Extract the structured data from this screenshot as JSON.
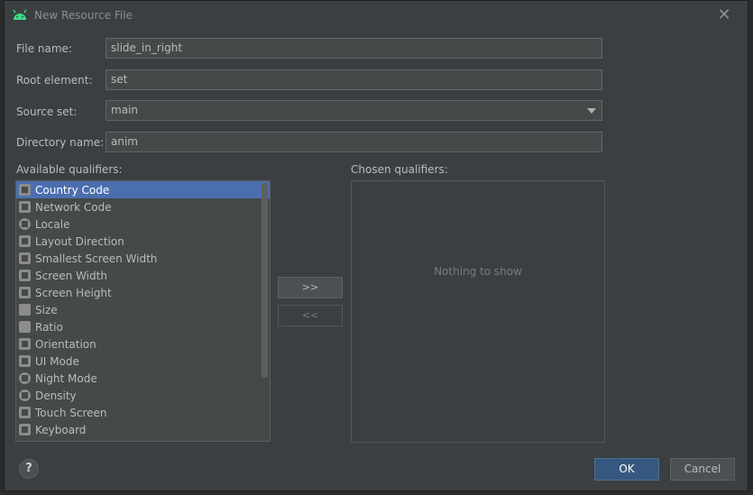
{
  "dialog": {
    "title": "New Resource File",
    "close_glyph": "✕"
  },
  "form": {
    "file_name_label": "File name:",
    "file_name_value": "slide_in_right",
    "root_element_label": "Root element:",
    "root_element_value": "set",
    "source_set_label": "Source set:",
    "source_set_value": "main",
    "directory_name_label": "Directory name:",
    "directory_name_value": "anim"
  },
  "qualifiers": {
    "available_label": "Available qualifiers:",
    "chosen_label": "Chosen qualifiers:",
    "items": [
      {
        "label": "Country Code",
        "icon": "country-code-icon"
      },
      {
        "label": "Network Code",
        "icon": "network-code-icon"
      },
      {
        "label": "Locale",
        "icon": "globe-icon"
      },
      {
        "label": "Layout Direction",
        "icon": "layout-direction-icon"
      },
      {
        "label": "Smallest Screen Width",
        "icon": "smallest-width-icon"
      },
      {
        "label": "Screen Width",
        "icon": "screen-width-icon"
      },
      {
        "label": "Screen Height",
        "icon": "screen-height-icon"
      },
      {
        "label": "Size",
        "icon": "size-icon"
      },
      {
        "label": "Ratio",
        "icon": "ratio-icon"
      },
      {
        "label": "Orientation",
        "icon": "orientation-icon"
      },
      {
        "label": "UI Mode",
        "icon": "ui-mode-icon"
      },
      {
        "label": "Night Mode",
        "icon": "night-mode-icon"
      },
      {
        "label": "Density",
        "icon": "density-icon"
      },
      {
        "label": "Touch Screen",
        "icon": "touch-screen-icon"
      },
      {
        "label": "Keyboard",
        "icon": "keyboard-icon"
      }
    ],
    "selected_index": 0,
    "add_label": ">>",
    "remove_label": "<<",
    "empty_text": "Nothing to show"
  },
  "footer": {
    "help_label": "?",
    "ok_label": "OK",
    "cancel_label": "Cancel"
  },
  "colors": {
    "accent": "#4b6eaf",
    "ok_button": "#365880",
    "dialog_bg": "#3c3f41",
    "android_green": "#3ddc84"
  }
}
